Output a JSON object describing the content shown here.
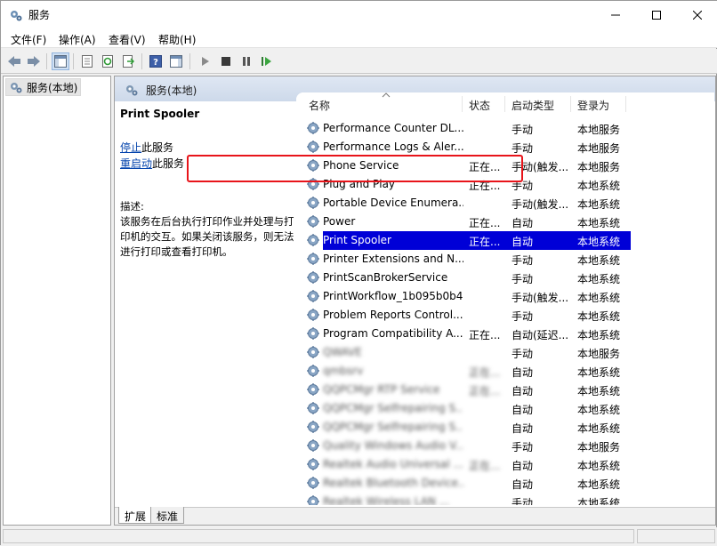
{
  "window": {
    "title": "服务",
    "minimize": "minimize",
    "maximize": "maximize",
    "close": "close"
  },
  "menu": [
    "文件(F)",
    "操作(A)",
    "查看(V)",
    "帮助(H)"
  ],
  "tree": {
    "root": "服务(本地)"
  },
  "pane_header": "服务(本地)",
  "selected_service": {
    "name": "Print Spooler",
    "stop_link": "停止",
    "stop_suffix": "此服务",
    "restart_link": "重启动",
    "restart_suffix": "此服务",
    "desc_label": "描述:",
    "description": "该服务在后台执行打印作业并处理与打印机的交互。如果关闭该服务，则无法进行打印或查看打印机。"
  },
  "columns": {
    "name": "名称",
    "status": "状态",
    "startup": "启动类型",
    "logon": "登录为"
  },
  "rows": [
    {
      "name": "Performance Counter DL...",
      "status": "",
      "startup": "手动",
      "logon": "本地服务"
    },
    {
      "name": "Performance Logs & Aler...",
      "status": "",
      "startup": "手动",
      "logon": "本地服务"
    },
    {
      "name": "Phone Service",
      "status": "正在...",
      "startup": "手动(触发...",
      "logon": "本地服务"
    },
    {
      "name": "Plug and Play",
      "status": "正在...",
      "startup": "手动",
      "logon": "本地系统"
    },
    {
      "name": "Portable Device Enumera...",
      "status": "",
      "startup": "手动(触发...",
      "logon": "本地系统"
    },
    {
      "name": "Power",
      "status": "正在...",
      "startup": "自动",
      "logon": "本地系统"
    },
    {
      "name": "Print Spooler",
      "status": "正在...",
      "startup": "自动",
      "logon": "本地系统",
      "selected": true
    },
    {
      "name": "Printer Extensions and N...",
      "status": "",
      "startup": "手动",
      "logon": "本地系统"
    },
    {
      "name": "PrintScanBrokerService",
      "status": "",
      "startup": "手动",
      "logon": "本地系统"
    },
    {
      "name": "PrintWorkflow_1b095b0b4",
      "status": "",
      "startup": "手动(触发...",
      "logon": "本地系统"
    },
    {
      "name": "Problem Reports Control...",
      "status": "",
      "startup": "手动",
      "logon": "本地系统"
    },
    {
      "name": "Program Compatibility A...",
      "status": "正在...",
      "startup": "自动(延迟...",
      "logon": "本地系统"
    },
    {
      "name": "QWAVE",
      "status": "",
      "startup": "手动",
      "logon": "本地服务",
      "blurred": true
    },
    {
      "name": "qmbsrv",
      "status": "正在...",
      "startup": "自动",
      "logon": "本地系统",
      "blurred": true
    },
    {
      "name": "QQPCMgr RTP Service",
      "status": "正在...",
      "startup": "自动",
      "logon": "本地系统",
      "blurred": true
    },
    {
      "name": "QQPCMgr Selfrepairing S...",
      "status": "",
      "startup": "自动",
      "logon": "本地系统",
      "blurred": true
    },
    {
      "name": "QQPCMgr Selfrepairing S...",
      "status": "",
      "startup": "自动",
      "logon": "本地系统",
      "blurred": true
    },
    {
      "name": "Quality Windows Audio V...",
      "status": "",
      "startup": "手动",
      "logon": "本地服务",
      "blurred": true
    },
    {
      "name": "Realtek Audio Universal ...",
      "status": "正在...",
      "startup": "自动",
      "logon": "本地系统",
      "blurred": true
    },
    {
      "name": "Realtek Bluetooth Device...",
      "status": "",
      "startup": "自动",
      "logon": "本地系统",
      "blurred": true
    },
    {
      "name": "Realtek Wireless LAN ...",
      "status": "",
      "startup": "手动",
      "logon": "本地系统",
      "blurred": true
    }
  ],
  "tabs": [
    "扩展",
    "标准"
  ],
  "colors": {
    "selection": "#0000d7",
    "highlight_box": "#e8141a",
    "header_band": "#cdd9ea"
  }
}
